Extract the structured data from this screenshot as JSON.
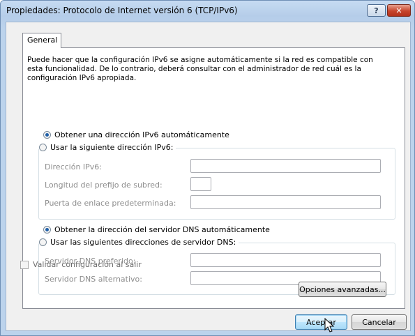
{
  "window": {
    "title": "Propiedades: Protocolo de Internet versión 6 (TCP/IPv6)",
    "help_glyph": "?",
    "close_glyph": "✕"
  },
  "tabs": [
    {
      "label": "General",
      "selected": true
    }
  ],
  "intro_text": "Puede hacer que la configuración IPv6 se asigne automáticamente si la red es compatible con esta funcionalidad. De lo contrario, deberá consultar con el administrador de red cuál es la configuración IPv6 apropiada.",
  "ip_section": {
    "auto_label": "Obtener una dirección IPv6 automáticamente",
    "auto_selected": true,
    "manual_label": "Usar la siguiente dirección IPv6:",
    "manual_selected": false,
    "fields": {
      "address_label": "Dirección IPv6:",
      "address_value": "",
      "prefix_label": "Longitud del prefijo de subred:",
      "prefix_value": "",
      "gateway_label": "Puerta de enlace predeterminada:",
      "gateway_value": ""
    }
  },
  "dns_section": {
    "auto_label": "Obtener la dirección del servidor DNS automáticamente",
    "auto_selected": true,
    "manual_label": "Usar las siguientes direcciones de servidor DNS:",
    "manual_selected": false,
    "fields": {
      "preferred_label": "Servidor DNS preferido:",
      "preferred_value": "",
      "alternate_label": "Servidor DNS alternativo:",
      "alternate_value": ""
    }
  },
  "validate_checkbox": {
    "label": "Validar configuración al salir",
    "checked": false
  },
  "buttons": {
    "advanced": "Opciones avanzadas...",
    "ok": "Aceptar",
    "cancel": "Cancelar"
  },
  "colors": {
    "accent": "#1f5fa8",
    "close": "#c7452c",
    "disabled_text": "#8d8d8d"
  }
}
